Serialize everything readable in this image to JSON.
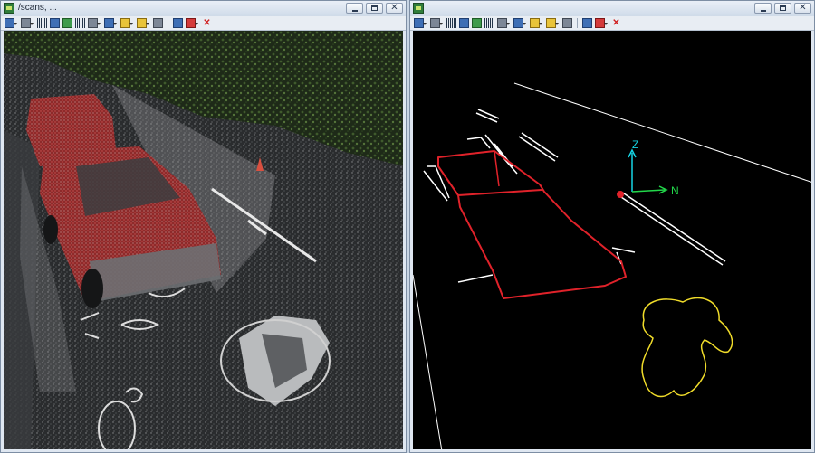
{
  "left_window": {
    "title": "/scans, ...",
    "buttons": {
      "minimize": "minimize",
      "maximize": "maximize",
      "close": "close"
    }
  },
  "right_window": {
    "title": "",
    "buttons": {
      "minimize": "minimize",
      "maximize": "maximize",
      "close": "close"
    }
  },
  "toolbar_icons": [
    "view-cube-icon",
    "pan-icon",
    "grid-icon",
    "measure-icon",
    "move-icon",
    "histogram-icon",
    "select-icon",
    "layers-icon",
    "light-icon",
    "arrow-icon",
    "export-icon",
    "camera-icon",
    "link-icon",
    "delete-icon"
  ],
  "axes": {
    "z": "Z",
    "n": "N"
  },
  "colors": {
    "accent_red": "#e0222a",
    "outline_yellow": "#f0dc2a",
    "lines_white": "#ffffff",
    "axis_cyan": "#16d4e4",
    "axis_green": "#22d84a"
  }
}
